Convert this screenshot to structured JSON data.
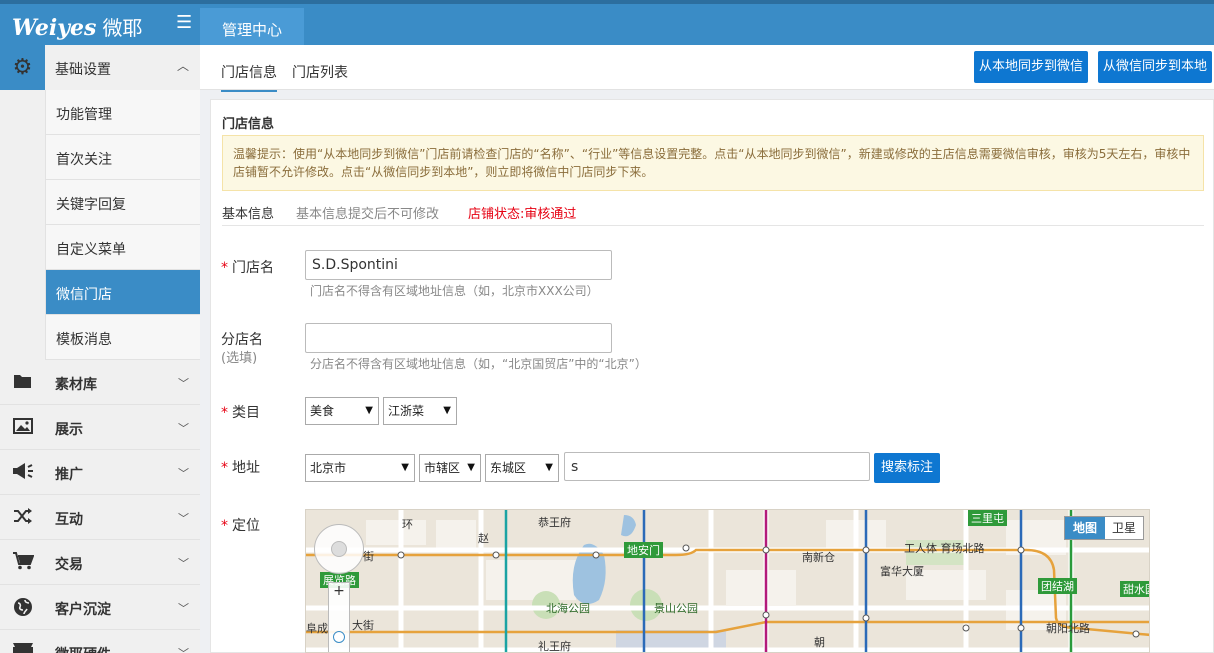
{
  "brand": {
    "name": "Weiyes",
    "name_cn": "微耶"
  },
  "top_tab": "管理中心",
  "sidebar": {
    "section": "基础设置",
    "sub_items": [
      "功能管理",
      "首次关注",
      "关键字回复",
      "自定义菜单",
      "微信门店",
      "模板消息"
    ],
    "active_sub": "微信门店",
    "items": [
      {
        "label": "素材库",
        "icon": "folder-icon"
      },
      {
        "label": "展示",
        "icon": "image-icon"
      },
      {
        "label": "推广",
        "icon": "megaphone-icon"
      },
      {
        "label": "互动",
        "icon": "shuffle-icon"
      },
      {
        "label": "交易",
        "icon": "cart-icon"
      },
      {
        "label": "客户沉淀",
        "icon": "globe-icon"
      },
      {
        "label": "微耶硬件",
        "icon": "film-icon"
      }
    ]
  },
  "tabs": [
    "门店信息",
    "门店列表"
  ],
  "buttons": {
    "sync_to_wechat": "从本地同步到微信",
    "sync_from_wechat": "从微信同步到本地",
    "search_mark": "搜索标注"
  },
  "panel_title": "门店信息",
  "notice": "温馨提示：使用“从本地同步到微信”门店前请检查门店的“名称”、“行业”等信息设置完整。点击“从本地同步到微信”，新建或修改的主店信息需要微信审核，审核为5天左右，审核中店铺暂不允许修改。点击“从微信同步到本地”，则立即将微信中门店同步下来。",
  "basic": {
    "title": "基本信息",
    "note": "基本信息提交后不可修改",
    "status": "店铺状态:审核通过"
  },
  "form": {
    "store_name": {
      "label": "门店名",
      "value": "S.D.Spontini",
      "hint": "门店名不得含有区域地址信息（如，北京市XXX公司）"
    },
    "branch_name": {
      "label": "分店名",
      "sub": "(选填)",
      "value": "",
      "hint": "分店名不得含有区域地址信息（如，“北京国贸店”中的“北京”）"
    },
    "category": {
      "label": "类目",
      "primary": "美食",
      "secondary": "江浙菜"
    },
    "address": {
      "label": "地址",
      "city": "北京市",
      "district_group": "市辖区",
      "district": "东城区",
      "detail": "s"
    },
    "location": {
      "label": "定位"
    }
  },
  "map": {
    "toggle_map": "地图",
    "toggle_satellite": "卫星",
    "labels": {
      "gongwangfu": "恭王府",
      "tiananmen": "地安门",
      "nanxinchang": "南新仓",
      "gongrentiyuchang": "工人体 育场北路",
      "fuhuadasha": "富华大厦",
      "beihaipark": "北海公园",
      "jingshanpark": "景山公园",
      "lishenfu": "礼王府",
      "zhanlanlu": "展览路",
      "sanlitun": "三里屯",
      "tuanjiehu": "团结湖",
      "tianshuiyuan": "甜水园",
      "chaoyangbeilu": "朝阳北路",
      "dajie": "大街",
      "jie": "街",
      "chao": "朝",
      "chengren": "阜成",
      "huan": "环",
      "zhao": "赵"
    }
  }
}
